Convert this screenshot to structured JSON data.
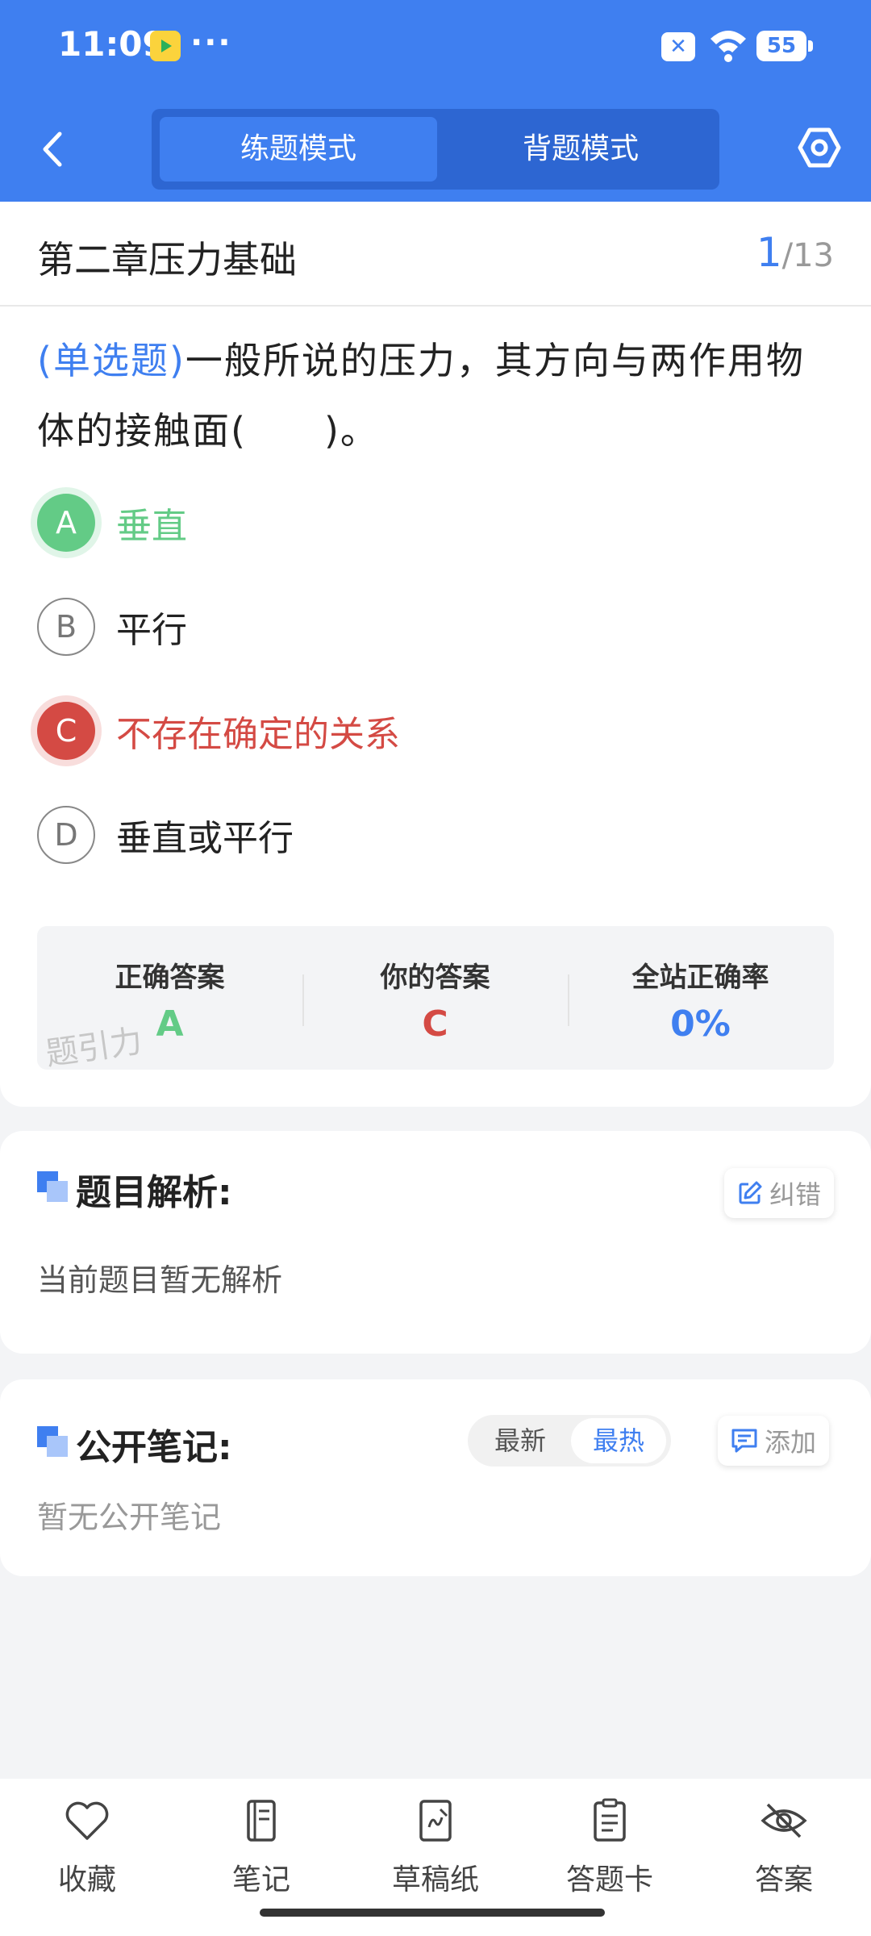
{
  "status_bar": {
    "time": "11:09",
    "dots": "···",
    "battery": "55"
  },
  "header": {
    "tabs": [
      {
        "label": "练题模式",
        "active": true
      },
      {
        "label": "背题模式",
        "active": false
      }
    ],
    "icons": {
      "back": "back-icon",
      "settings": "settings-hexagon-icon"
    }
  },
  "title_bar": {
    "chapter": "第二章压力基础",
    "current": "1",
    "total": "/13"
  },
  "question": {
    "type": "(单选题)",
    "text": "一般所说的压力，其方向与两作用物体的接触面(　　)。"
  },
  "options": [
    {
      "letter": "A",
      "text": "垂直",
      "state": "correct"
    },
    {
      "letter": "B",
      "text": "平行",
      "state": "normal"
    },
    {
      "letter": "C",
      "text": "不存在确定的关系",
      "state": "wrong"
    },
    {
      "letter": "D",
      "text": "垂直或平行",
      "state": "normal"
    }
  ],
  "answer_summary": {
    "correct_label": "正确答案",
    "correct_value": "A",
    "yours_label": "你的答案",
    "yours_value": "C",
    "rate_label": "全站正确率",
    "rate_value": "0%",
    "watermark": "题引力"
  },
  "analysis": {
    "title": "题目解析:",
    "report_label": "纠错",
    "empty": "当前题目暂无解析"
  },
  "notes": {
    "title": "公开笔记:",
    "sort_options": [
      "最新",
      "最热"
    ],
    "sort_selected": "最热",
    "add_label": "添加",
    "empty": "暂无公开笔记"
  },
  "bottom_nav": [
    {
      "label": "收藏",
      "icon": "heart-icon"
    },
    {
      "label": "笔记",
      "icon": "notebook-icon"
    },
    {
      "label": "草稿纸",
      "icon": "draft-paper-icon"
    },
    {
      "label": "答题卡",
      "icon": "answer-card-icon"
    },
    {
      "label": "答案",
      "icon": "eye-off-icon"
    }
  ],
  "colors": {
    "primary": "#3f7ff0",
    "correct": "#63cb86",
    "wrong": "#d44a44"
  }
}
